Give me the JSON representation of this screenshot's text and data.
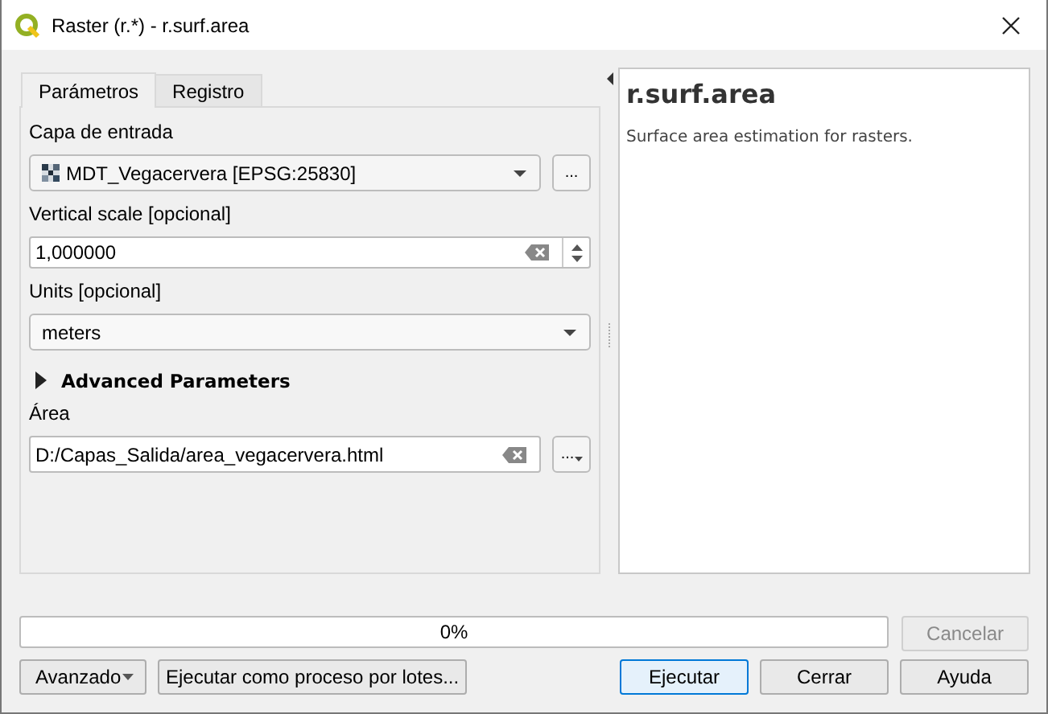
{
  "window": {
    "title": "Raster (r.*) - r.surf.area"
  },
  "tabs": [
    {
      "label": "Parámetros",
      "selected": true
    },
    {
      "label": "Registro",
      "selected": false
    }
  ],
  "params": [
    {
      "kind": "layer",
      "label": "Capa de entrada",
      "value": "MDT_Vegacervera [EPSG:25830]",
      "button": "..."
    },
    {
      "kind": "number",
      "label": "Vertical scale [opcional]",
      "value": "1,000000"
    },
    {
      "kind": "select",
      "label": "Units [opcional]",
      "value": "meters"
    },
    {
      "kind": "group",
      "label": "Advanced Parameters",
      "expanded": false
    },
    {
      "kind": "file",
      "label": "Área",
      "value": "D:/Capas_Salida/area_vegacervera.html",
      "button": "..."
    }
  ],
  "help": {
    "title": "r.surf.area",
    "description": "Surface area estimation for rasters."
  },
  "progress": {
    "level": 0,
    "reading": "0%"
  },
  "cancel": {
    "label": "Cancelar",
    "disabled": true
  },
  "left_buttons": [
    {
      "label": "Avanzado",
      "kind": "menu"
    },
    {
      "label": "Ejecutar como proceso por lotes...",
      "kind": "plain"
    }
  ],
  "right_buttons": [
    {
      "label": "Ejecutar",
      "default": true
    },
    {
      "label": "Cerrar",
      "default": false
    },
    {
      "label": "Ayuda",
      "default": false
    }
  ]
}
